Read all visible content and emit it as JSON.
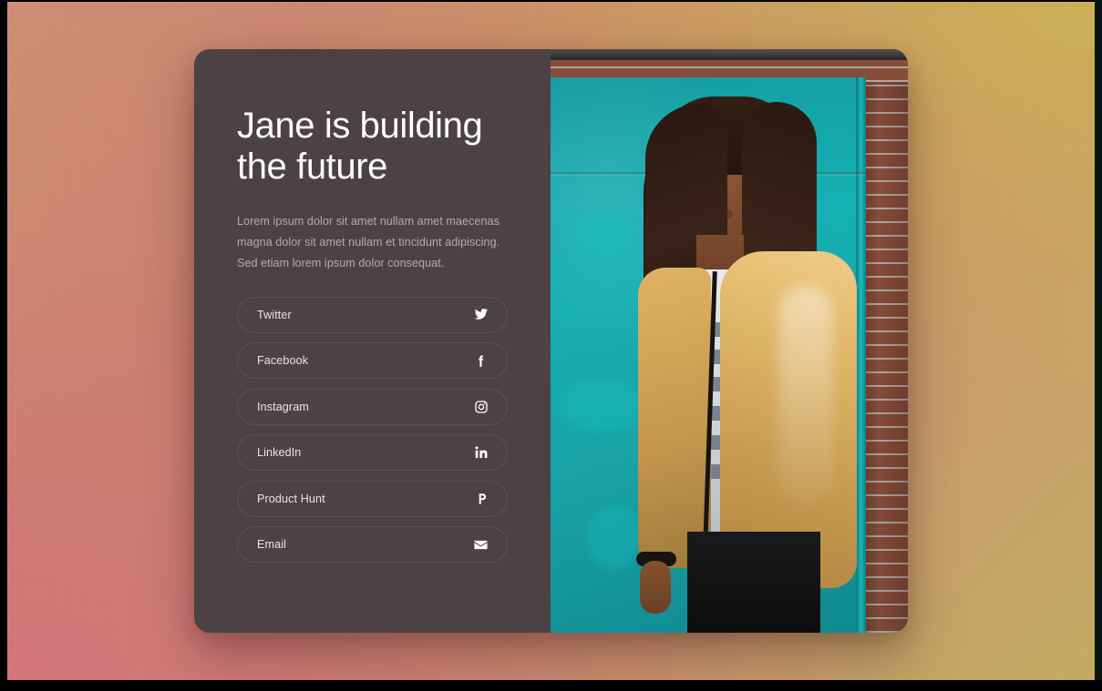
{
  "page": {
    "background_colors": {
      "top_left": "#cf8e74",
      "top_right": "#c2ab63",
      "bottom_left": "#d4757a",
      "bottom_right": "#c99a6d"
    }
  },
  "card": {
    "background_color": "#4c4245",
    "headline": "Jane is building\nthe future",
    "intro": "Lorem ipsum dolor sit amet nullam amet maecenas magna dolor sit amet nullam et tincidunt adipiscing. Sed etiam lorem ipsum dolor consequat.",
    "text_colors": {
      "headline": "#fdfcfc",
      "intro": "#b5aaab",
      "button_label": "#e9e5e6",
      "button_border": "#5d5256"
    }
  },
  "social_links": [
    {
      "label": "Twitter",
      "icon": "twitter-icon"
    },
    {
      "label": "Facebook",
      "icon": "facebook-icon"
    },
    {
      "label": "Instagram",
      "icon": "instagram-icon"
    },
    {
      "label": "LinkedIn",
      "icon": "linkedin-icon"
    },
    {
      "label": "Product Hunt",
      "icon": "product-hunt-icon"
    },
    {
      "label": "Email",
      "icon": "envelope-icon"
    }
  ],
  "photo": {
    "description": "Woman in gold windbreaker jacket standing in front of a teal door with brick wall",
    "colors": {
      "door": "#14b0b3",
      "brick": "#8d4f3c",
      "jacket": "#e3b868",
      "pants": "#131315",
      "shirt": "#dde2e6"
    }
  }
}
